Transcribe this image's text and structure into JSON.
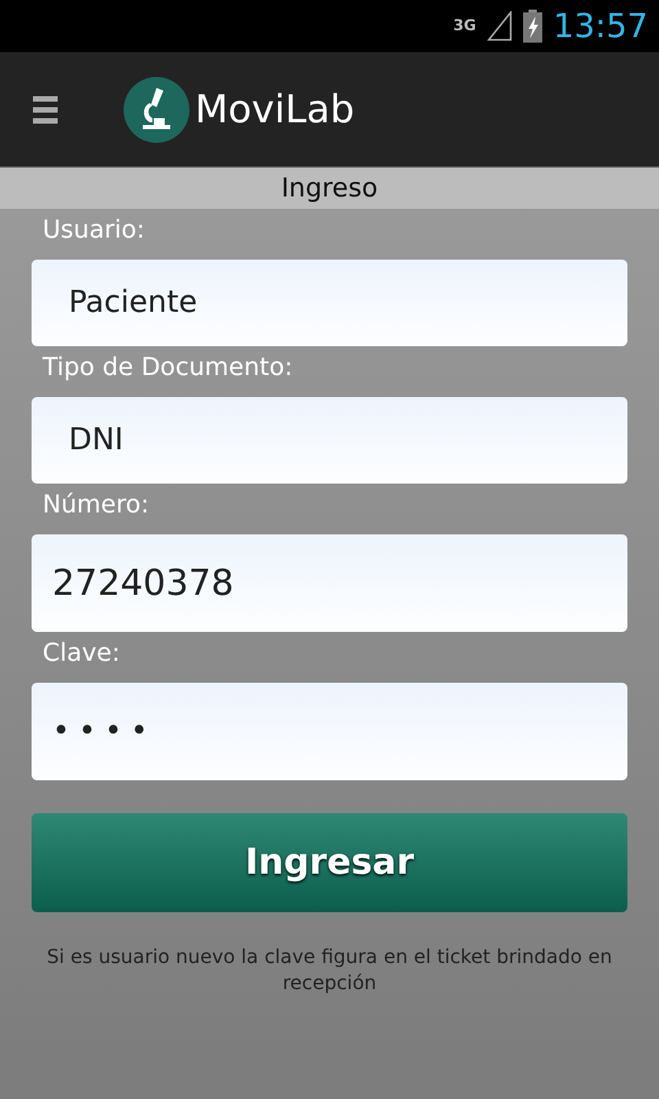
{
  "status_bar": {
    "network": "3G",
    "time": "13:57"
  },
  "app_bar": {
    "title": "MoviLab"
  },
  "section_title": "Ingreso",
  "fields": [
    {
      "label": "Usuario:",
      "kind": "select",
      "value": "Paciente"
    },
    {
      "label": "Tipo de Documento:",
      "kind": "select",
      "value": "DNI"
    },
    {
      "label": "Número:",
      "kind": "input",
      "value": "27240378"
    },
    {
      "label": "Clave:",
      "kind": "password",
      "value": "••••"
    }
  ],
  "button": "Ingresar",
  "note": "Si es usuario nuevo la clave figura en el ticket brindado en recepción"
}
